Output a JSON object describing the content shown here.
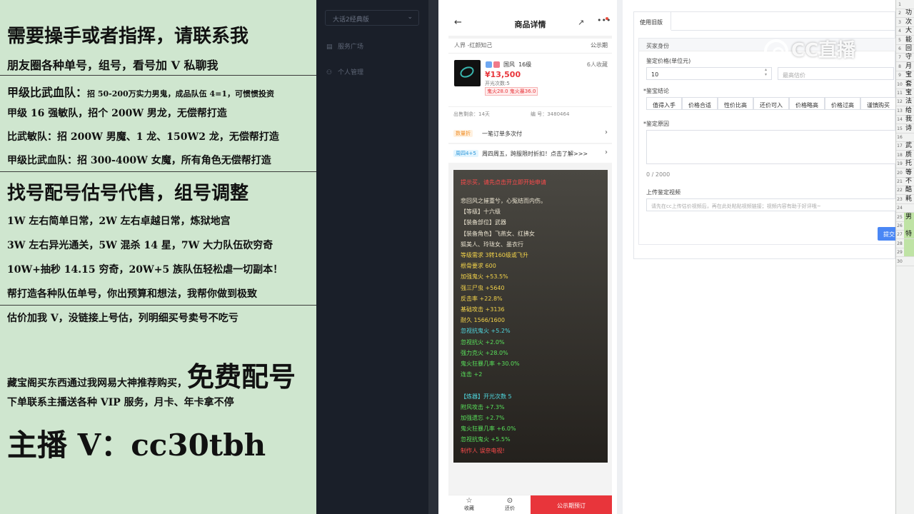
{
  "promo": {
    "line1": "需要操手或者指挥，请联系我",
    "line2": "朋友圈各种单号，组号，看号加 V 私聊我",
    "line3a": "甲级比武血队：",
    "line3b": "招 50-200万实力男鬼，成品队伍 4=1，可惯惯投资",
    "line4": "甲级 16 强敏队，招个 200W 男龙，无偿帮打造",
    "line5": "比武敏队：招 200W 男魔、1 龙、150W2 龙，无偿帮打造",
    "line6": "甲级比武血队：招 300-400W 女魔，所有角色无偿帮打造",
    "line7": "找号配号估号代售，组号调整",
    "line8": "1W 左右简单日常，2W 左右卓越日常，炼狱地宫",
    "line9": "3W 左右异光通关，5W 混杀 14 星，7W 大力队伍砍穷奇",
    "line10": "10W+抽秒 14.15 穷奇，20W+5 族队伍轻松虐一切副本！",
    "line11": "帮打造各种队伍单号，你出预算和想法，我帮你做到极致",
    "line12": "估价加我 V，没链接上号估，列明细买号卖号不吃亏",
    "line13a": "藏宝阁买东西通过我网易大神推荐购买，",
    "line13b": "免费配号",
    "line14": "下单联系主播送各种 VIP 服务，月卡、年卡拿不停",
    "line15": "主播 V：cc30tbh"
  },
  "sidebar": {
    "select": "大话2经典版",
    "items": [
      "服务广场",
      "个人管理"
    ]
  },
  "phone": {
    "title": "商品详情",
    "breadcrumb": "人界 -红颜知己",
    "public": "公示期",
    "tag_name": "国风",
    "level": "16级",
    "fav": "6人收藏",
    "price": "¥13,500",
    "kaiguang": "开光次数:5",
    "note": "鬼火28.0 鬼火暴36.0",
    "meta_left": "出售剩余：14天",
    "meta_right": "编 号：3480464",
    "row1_badge": "数量折",
    "row1": "一笔订单多次付",
    "row2_badge": "周四4+5",
    "row2": "周四周五，跨服限时折扣！点击了解>>>",
    "desc_head": "提示买，请先点击开立即开始申请",
    "desc": [
      {
        "t": "悲回风之摧重兮，心冤结而内伤。",
        "c": "#e9e2cf"
      },
      {
        "t": "【等级】十六级",
        "c": "#e9e2cf"
      },
      {
        "t": "【装备部位】武器",
        "c": "#e9e2cf"
      },
      {
        "t": "【装备角色】飞燕女、红拂女",
        "c": "#e9e2cf"
      },
      {
        "t": "狐美人、玲珑女、墨衣行",
        "c": "#e9e2cf"
      },
      {
        "t": "等级需求 3转160级或飞升",
        "c": "#f3d34a"
      },
      {
        "t": "根骨要求 600",
        "c": "#f3d34a"
      },
      {
        "t": "加强鬼火 +53.5%",
        "c": "#f3d34a"
      },
      {
        "t": "强三尸虫 +5640",
        "c": "#f3d34a"
      },
      {
        "t": "反击率 +22.8%",
        "c": "#f3d34a"
      },
      {
        "t": "基础攻击 +3136",
        "c": "#f3d34a"
      },
      {
        "t": "耐久 1566/1600",
        "c": "#f3d34a"
      },
      {
        "t": "忽视抗鬼火 +5.2%",
        "c": "#4fd8e0"
      },
      {
        "t": "忽视抗火 +2.0%",
        "c": "#58e05a"
      },
      {
        "t": "强力克火 +28.0%",
        "c": "#58e05a"
      },
      {
        "t": "鬼火狂暴几率 +30.0%",
        "c": "#58e05a"
      },
      {
        "t": "连击 +2",
        "c": "#58e05a"
      },
      {
        "t": "",
        "c": "#fff"
      },
      {
        "t": "【炼器】开光次数 5",
        "c": "#4fd8e0"
      },
      {
        "t": "附风攻击 +7.3%",
        "c": "#58e05a"
      },
      {
        "t": "加强遗忘 +2.7%",
        "c": "#58e05a"
      },
      {
        "t": "鬼火狂暴几率 +6.0%",
        "c": "#58e05a"
      },
      {
        "t": "忽视抗鬼火 +5.5%",
        "c": "#58e05a"
      },
      {
        "t": "制作人 误奈电视!",
        "c": "#ff4b4b"
      }
    ],
    "foot": {
      "fav": "收藏",
      "bargain": "还价",
      "buy": "公示期预订"
    }
  },
  "form": {
    "tab": "使用旧版",
    "section": "买家身份",
    "price_label": "鉴定价格(单位元)",
    "price_value": "10",
    "max_placeholder": "最高估价",
    "conclusion_label": "*鉴宝结论",
    "options": [
      "值得入手",
      "价格合适",
      "性价比高",
      "还价可入",
      "价格略高",
      "价格过高",
      "谨慎购买"
    ],
    "reason_label": "*鉴定原因",
    "counter": "0 / 2000",
    "video_label": "上传鉴定视频",
    "video_placeholder": "请先在cc上传估价视频后，再在此处粘贴视频链接；视频内容有助于好评哦~",
    "submit": "提交"
  },
  "watermark": "CC直播",
  "excel": {
    "rows": [
      "1",
      "2",
      "3",
      "4",
      "5",
      "6",
      "7",
      "8",
      "9",
      "10",
      "11",
      "12",
      "13",
      "14",
      "15",
      "16",
      "17",
      "18",
      "19",
      "20",
      "21",
      "22",
      "23",
      "24",
      "25",
      "26",
      "27",
      "28",
      "29",
      "30"
    ],
    "cells": [
      "",
      "功",
      "次",
      "大",
      "能",
      "回",
      "守",
      "月",
      "宝",
      "套",
      "宝",
      "法",
      "给",
      "我",
      "诗",
      "",
      "武",
      "质",
      "托",
      "等",
      "不",
      "酷",
      "耗",
      "",
      "男",
      "",
      "特",
      "",
      "",
      ""
    ]
  }
}
